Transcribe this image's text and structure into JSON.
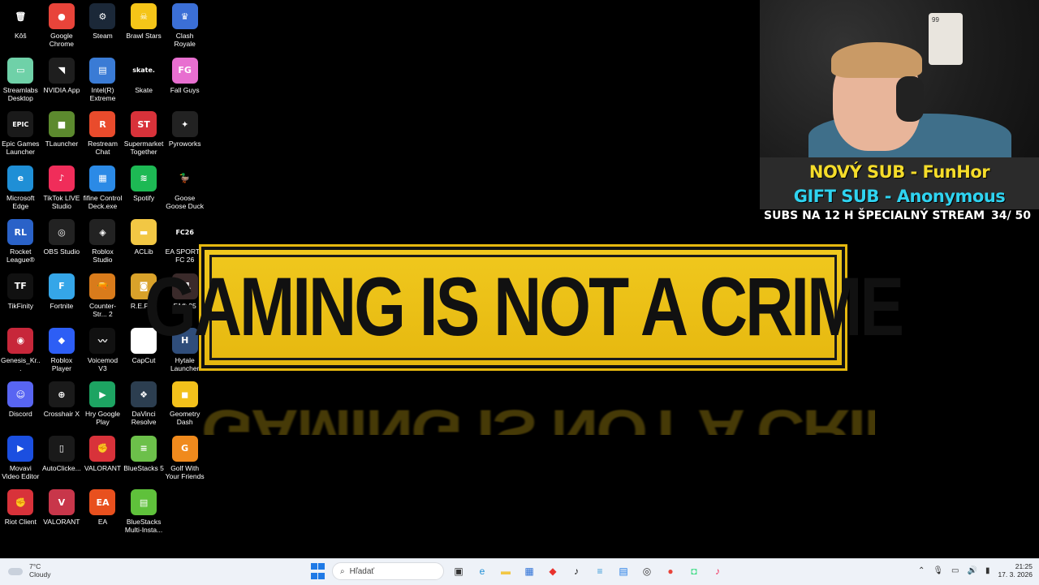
{
  "desktop": {
    "icons": [
      {
        "label": "Kôš",
        "glyph": "🗑",
        "color": "#00000000"
      },
      {
        "label": "Streamlabs Desktop",
        "glyph": "▭",
        "color": "#6fd1a8"
      },
      {
        "label": "Epic Games Launcher",
        "glyph": "EPIC",
        "color": "#1a1a1a"
      },
      {
        "label": "Microsoft Edge",
        "glyph": "e",
        "color": "#1f8fd6"
      },
      {
        "label": "Rocket League®",
        "glyph": "RL",
        "color": "#2a62c8"
      },
      {
        "label": "TikFinity",
        "glyph": "TF",
        "color": "#111111"
      },
      {
        "label": "Genesis_Kr...",
        "glyph": "◉",
        "color": "#c7273a"
      },
      {
        "label": "Discord",
        "glyph": "☺",
        "color": "#5865f2"
      },
      {
        "label": "Movavi Video Editor 25",
        "glyph": "▶",
        "color": "#1b4fe0"
      },
      {
        "label": "Riot Client",
        "glyph": "✊",
        "color": "#d8323a"
      },
      {
        "label": "Google Chrome",
        "glyph": "●",
        "color": "#e8443a"
      },
      {
        "label": "NVIDIA App",
        "glyph": "◥",
        "color": "#1e1e1e"
      },
      {
        "label": "TLauncher",
        "glyph": "■",
        "color": "#5c8a2e"
      },
      {
        "label": "TikTok LIVE Studio",
        "glyph": "♪",
        "color": "#f02d5a"
      },
      {
        "label": "OBS Studio",
        "glyph": "◎",
        "color": "#222222"
      },
      {
        "label": "Fortnite",
        "glyph": "F",
        "color": "#35a6e8"
      },
      {
        "label": "Roblox Player",
        "glyph": "◆",
        "color": "#2d5ef5"
      },
      {
        "label": "Crosshair X",
        "glyph": "⊕",
        "color": "#1a1a1a"
      },
      {
        "label": "AutoClicke...",
        "glyph": "▯",
        "color": "#1a1a1a"
      },
      {
        "label": "VALORANT",
        "glyph": "V",
        "color": "#c8364a"
      },
      {
        "label": "Steam",
        "glyph": "⚙",
        "color": "#1b2838"
      },
      {
        "label": "Intel(R) Extreme Tu...",
        "glyph": "▤",
        "color": "#3a7bd5"
      },
      {
        "label": "Restream Chat",
        "glyph": "R",
        "color": "#e94b2c"
      },
      {
        "label": "fifine Control Deck.exe",
        "glyph": "▦",
        "color": "#2b8ae6"
      },
      {
        "label": "Roblox Studio",
        "glyph": "◈",
        "color": "#222222"
      },
      {
        "label": "Counter-Str... 2",
        "glyph": "🔫",
        "color": "#d97b1b"
      },
      {
        "label": "Voicemod V3",
        "glyph": "〰",
        "color": "#111111"
      },
      {
        "label": "Hry Google Play",
        "glyph": "▶",
        "color": "#1da462"
      },
      {
        "label": "VALORANT",
        "glyph": "✊",
        "color": "#d8323a"
      },
      {
        "label": "EA",
        "glyph": "EA",
        "color": "#e8501e"
      },
      {
        "label": "Brawl Stars",
        "glyph": "☠",
        "color": "#f5c518"
      },
      {
        "label": "Skate",
        "glyph": "skate.",
        "color": "#000000"
      },
      {
        "label": "Supermarket Together",
        "glyph": "ST",
        "color": "#d8323a"
      },
      {
        "label": "Spotify",
        "glyph": "≋",
        "color": "#1db954"
      },
      {
        "label": "ACLib",
        "glyph": "▬",
        "color": "#f2c744"
      },
      {
        "label": "R.E.P.O.",
        "glyph": "◙",
        "color": "#d9a22a"
      },
      {
        "label": "CapCut",
        "glyph": "✂",
        "color": "#ffffff"
      },
      {
        "label": "DaVinci Resolve",
        "glyph": "❖",
        "color": "#2c3e50"
      },
      {
        "label": "BlueStacks 5",
        "glyph": "≡",
        "color": "#6cc04a"
      },
      {
        "label": "BlueStacks Multi-Insta...",
        "glyph": "▤",
        "color": "#5fc13b"
      },
      {
        "label": "Clash Royale",
        "glyph": "♛",
        "color": "#3b6fd6"
      },
      {
        "label": "Fall Guys",
        "glyph": "FG",
        "color": "#e86fd0"
      },
      {
        "label": "Pyroworks",
        "glyph": "✦",
        "color": "#222222"
      },
      {
        "label": "Goose Goose Duck",
        "glyph": "🦆",
        "color": "#00000000"
      },
      {
        "label": "EA SPORTS FC 26",
        "glyph": "FC26",
        "color": "#000000"
      },
      {
        "label": "F1® 25",
        "glyph": "F1",
        "color": "#3a2a2a"
      },
      {
        "label": "Hytale Launcher",
        "glyph": "H",
        "color": "#2f4d7a"
      },
      {
        "label": "Geometry Dash",
        "glyph": "◼",
        "color": "#f3c11b"
      },
      {
        "label": "Golf With Your Friends",
        "glyph": "G",
        "color": "#f08a1d"
      }
    ]
  },
  "wallpaper": {
    "banner_text": "GAMING IS NOT A CRIME"
  },
  "stream_overlay": {
    "alert_new_sub": "NOVÝ SUB - FunHor",
    "alert_gift_sub": "GIFT SUB - Anonymous",
    "goal_label": "SUBS NA 12 H ŠPECIALNÝ STREAM",
    "goal_progress": "34/ 50",
    "card_value": "99"
  },
  "taskbar": {
    "weather_temp": "7°C",
    "weather_desc": "Cloudy",
    "search_placeholder": "Hľadať",
    "clock_time": "21:25",
    "clock_date": "17. 3. 2026",
    "pinned": [
      {
        "name": "task-view",
        "glyph": "▣",
        "color": "#333333"
      },
      {
        "name": "edge",
        "glyph": "e",
        "color": "#1f8fd6"
      },
      {
        "name": "file-explorer",
        "glyph": "▬",
        "color": "#f2c744"
      },
      {
        "name": "store",
        "glyph": "▦",
        "color": "#2a6fd6"
      },
      {
        "name": "app-red",
        "glyph": "◆",
        "color": "#e8322d"
      },
      {
        "name": "tiktok",
        "glyph": "♪",
        "color": "#111111"
      },
      {
        "name": "notepad",
        "glyph": "≡",
        "color": "#3a9ad9"
      },
      {
        "name": "monitor",
        "glyph": "▤",
        "color": "#1f7ae6"
      },
      {
        "name": "obs",
        "glyph": "◎",
        "color": "#333333"
      },
      {
        "name": "chrome",
        "glyph": "●",
        "color": "#e8443a"
      },
      {
        "name": "android",
        "glyph": "◘",
        "color": "#3ddc84"
      },
      {
        "name": "tiktok-live",
        "glyph": "♪",
        "color": "#f02d5a"
      }
    ]
  }
}
